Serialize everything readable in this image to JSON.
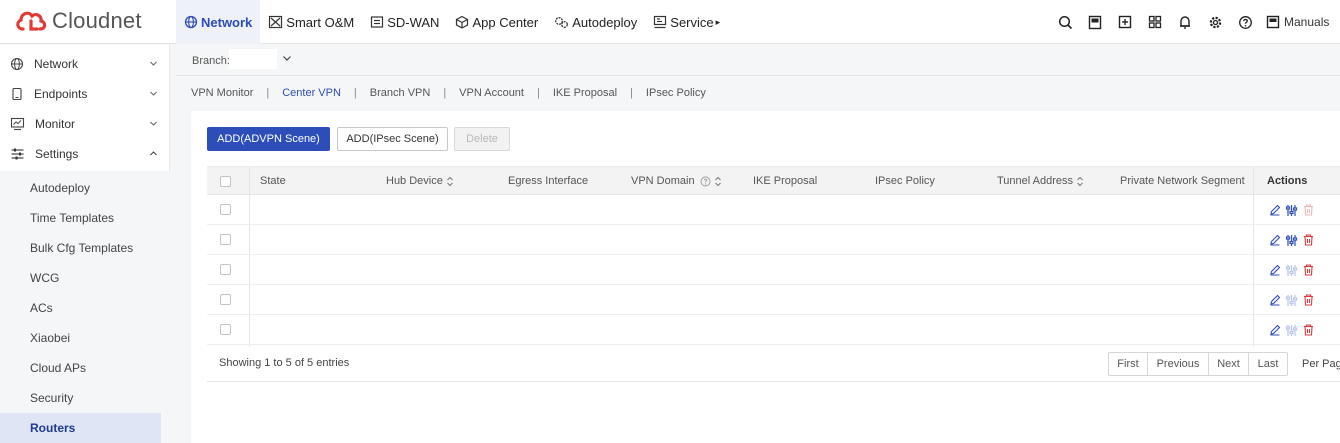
{
  "brand": {
    "name": "Cloudnet",
    "color": "#e23b36"
  },
  "accent": "#2d4db9",
  "nav": [
    {
      "label": "Network",
      "icon": "globe-icon",
      "active": true
    },
    {
      "label": "Smart O&M",
      "icon": "wrench-icon"
    },
    {
      "label": "SD-WAN",
      "icon": "sdwan-icon"
    },
    {
      "label": "App Center",
      "icon": "cube-icon"
    },
    {
      "label": "Autodeploy",
      "icon": "gears-icon"
    },
    {
      "label": "Service",
      "icon": "service-icon",
      "suffix": "▸"
    }
  ],
  "top_icons": [
    "search-icon",
    "notebook-icon",
    "plus-square-icon",
    "grid-icon",
    "bell-icon",
    "gear-icon",
    "help-icon"
  ],
  "manuals_label": "Manuals",
  "sidebar": {
    "items": [
      {
        "label": "Network",
        "icon": "globe-icon",
        "expanded": false
      },
      {
        "label": "Endpoints",
        "icon": "device-icon",
        "expanded": false
      },
      {
        "label": "Monitor",
        "icon": "monitor-icon",
        "expanded": false
      },
      {
        "label": "Settings",
        "icon": "sliders-icon",
        "expanded": true
      }
    ],
    "sub_items": [
      "Autodeploy",
      "Time Templates",
      "Bulk Cfg Templates",
      "WCG",
      "ACs",
      "Xiaobei",
      "Cloud APs",
      "Security",
      "Routers"
    ],
    "active_sub": "Routers"
  },
  "branch": {
    "label": "Branch:",
    "value": ""
  },
  "subtabs": [
    {
      "label": "VPN Monitor"
    },
    {
      "label": "Center VPN",
      "active": true
    },
    {
      "label": "Branch VPN"
    },
    {
      "label": "VPN Account"
    },
    {
      "label": "IKE Proposal"
    },
    {
      "label": "IPsec Policy"
    }
  ],
  "buttons": {
    "add_advpn": "ADD(ADVPN Scene)",
    "add_ipsec": "ADD(IPsec Scene)",
    "delete": "Delete"
  },
  "table": {
    "columns": [
      "State",
      "Hub Device",
      "Egress Interface",
      "VPN Domain",
      "IKE Proposal",
      "IPsec Policy",
      "Tunnel Address",
      "Private Network Segment"
    ],
    "actions_header": "Actions",
    "rows": [
      {
        "configure_enabled": true,
        "delete_enabled": false
      },
      {
        "configure_enabled": true,
        "delete_enabled": true
      },
      {
        "configure_enabled": false,
        "delete_enabled": true
      },
      {
        "configure_enabled": false,
        "delete_enabled": true
      },
      {
        "configure_enabled": false,
        "delete_enabled": true
      }
    ]
  },
  "pagination": {
    "showing": "Showing 1 to 5 of 5 entries",
    "first": "First",
    "previous": "Previous",
    "next": "Next",
    "last": "Last",
    "per_page": "Per Pag"
  }
}
